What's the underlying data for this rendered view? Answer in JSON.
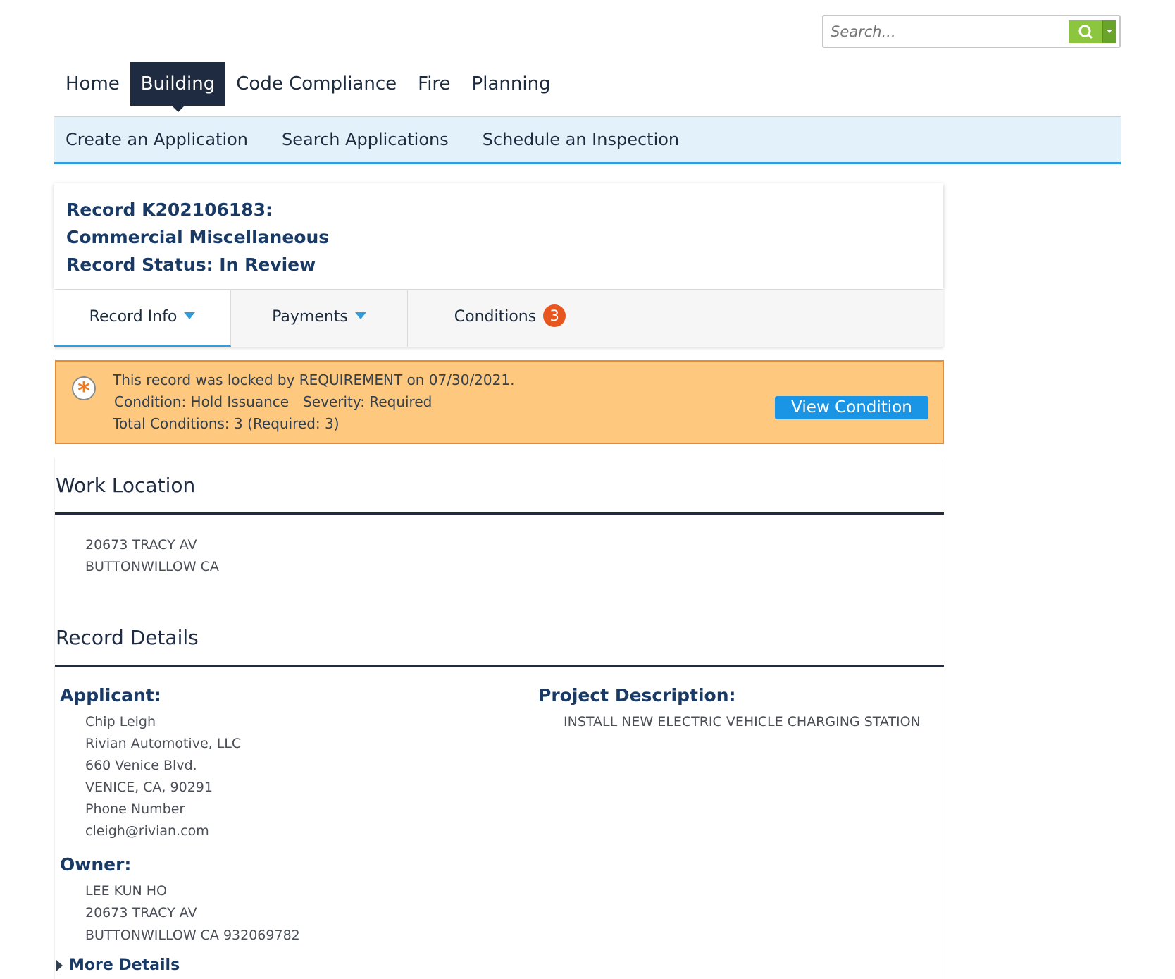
{
  "search": {
    "placeholder": "Search..."
  },
  "main_nav": {
    "items": [
      "Home",
      "Building",
      "Code Compliance",
      "Fire",
      "Planning"
    ],
    "active": "Building"
  },
  "sub_nav": [
    "Create an Application",
    "Search Applications",
    "Schedule an Inspection"
  ],
  "record": {
    "line1": "Record K202106183:",
    "line2": "Commercial Miscellaneous",
    "line3": "Record Status: In Review"
  },
  "tabs": {
    "record_info": "Record Info",
    "payments": "Payments",
    "conditions": "Conditions",
    "conditions_count": "3"
  },
  "alert": {
    "message": "This record was locked by REQUIREMENT on 07/30/2021.",
    "condition": "Condition: Hold Issuance",
    "severity": "Severity: Required",
    "totals": "Total Conditions: 3 (Required: 3)",
    "button": "View Condition",
    "icon_glyph": "*"
  },
  "work_location": {
    "title": "Work Location",
    "address1": "20673 TRACY AV",
    "address2": "BUTTONWILLOW CA"
  },
  "record_details": {
    "title": "Record Details",
    "applicant": {
      "label": "Applicant:",
      "lines": [
        "Chip Leigh",
        "Rivian Automotive, LLC",
        "660 Venice Blvd.",
        "VENICE, CA, 90291",
        "Phone Number",
        "cleigh@rivian.com"
      ]
    },
    "owner": {
      "label": "Owner:",
      "lines": [
        "LEE KUN HO",
        "20673 TRACY AV",
        "BUTTONWILLOW CA 932069782"
      ]
    },
    "project": {
      "label": "Project Description:",
      "value": "INSTALL NEW ELECTRIC VEHICLE CHARGING STATION"
    },
    "more_details": "More Details"
  },
  "colors": {
    "nav_active": "#1e2b40",
    "accent_blue": "#2e9ddd",
    "alert_bg": "#fec97f",
    "alert_border": "#ec8b2c",
    "badge": "#e8561f",
    "search_btn": "#8cc63f",
    "heading_blue": "#1a3a66"
  }
}
